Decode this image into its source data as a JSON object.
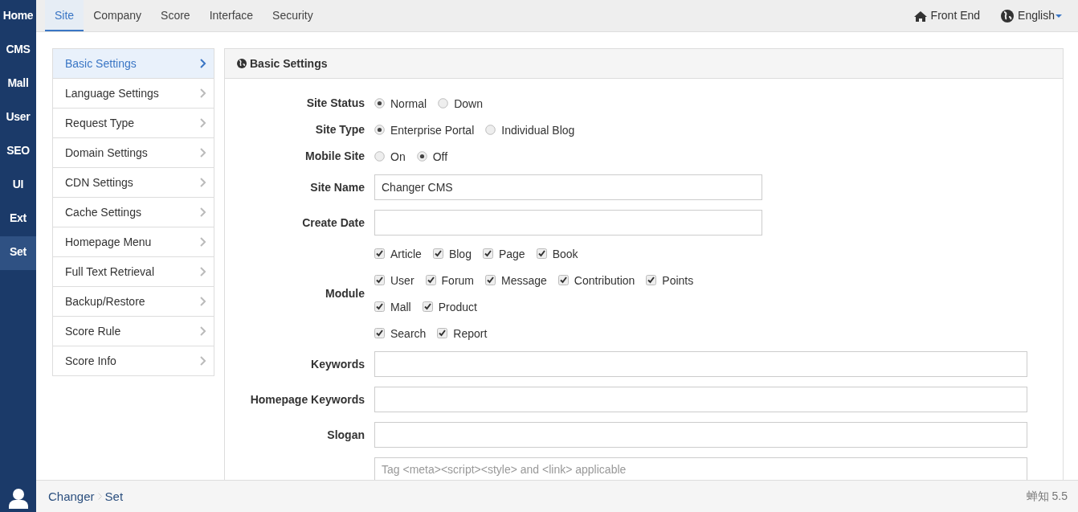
{
  "rail": {
    "items": [
      {
        "label": "Home",
        "selected": false
      },
      {
        "label": "CMS",
        "selected": false
      },
      {
        "label": "Mall",
        "selected": false
      },
      {
        "label": "User",
        "selected": false
      },
      {
        "label": "SEO",
        "selected": false
      },
      {
        "label": "UI",
        "selected": false
      },
      {
        "label": "Ext",
        "selected": false
      },
      {
        "label": "Set",
        "selected": true
      }
    ]
  },
  "tabs": [
    {
      "label": "Site",
      "selected": true
    },
    {
      "label": "Company",
      "selected": false
    },
    {
      "label": "Score",
      "selected": false
    },
    {
      "label": "Interface",
      "selected": false
    },
    {
      "label": "Security",
      "selected": false
    }
  ],
  "top_links": {
    "front_end": "Front End",
    "language": "English"
  },
  "side_menu": [
    {
      "label": "Basic Settings",
      "selected": true
    },
    {
      "label": "Language Settings",
      "selected": false
    },
    {
      "label": "Request Type",
      "selected": false
    },
    {
      "label": "Domain Settings",
      "selected": false
    },
    {
      "label": "CDN Settings",
      "selected": false
    },
    {
      "label": "Cache Settings",
      "selected": false
    },
    {
      "label": "Homepage Menu",
      "selected": false
    },
    {
      "label": "Full Text Retrieval",
      "selected": false
    },
    {
      "label": "Backup/Restore",
      "selected": false
    },
    {
      "label": "Score Rule",
      "selected": false
    },
    {
      "label": "Score Info",
      "selected": false
    }
  ],
  "panel": {
    "title": "Basic Settings",
    "fields": [
      {
        "kind": "radio",
        "label": "Site Status",
        "options": [
          {
            "label": "Normal",
            "selected": true
          },
          {
            "label": "Down",
            "selected": false
          }
        ]
      },
      {
        "kind": "radio",
        "label": "Site Type",
        "options": [
          {
            "label": "Enterprise Portal",
            "selected": true
          },
          {
            "label": "Individual Blog",
            "selected": false
          }
        ]
      },
      {
        "kind": "radio",
        "label": "Mobile Site",
        "options": [
          {
            "label": "On",
            "selected": false
          },
          {
            "label": "Off",
            "selected": true
          }
        ]
      },
      {
        "kind": "text",
        "label": "Site Name",
        "value": "Changer CMS"
      },
      {
        "kind": "text",
        "label": "Create Date"
      },
      {
        "kind": "checkboxes",
        "label": "Module",
        "rows": [
          [
            {
              "label": "Article",
              "checked": true
            },
            {
              "label": "Blog",
              "checked": true
            },
            {
              "label": "Page",
              "checked": true
            },
            {
              "label": "Book",
              "checked": true
            }
          ],
          [
            {
              "label": "User",
              "checked": true
            },
            {
              "label": "Forum",
              "checked": true
            },
            {
              "label": "Message",
              "checked": true
            },
            {
              "label": "Contribution",
              "checked": true
            },
            {
              "label": "Points",
              "checked": true
            }
          ],
          [
            {
              "label": "Mall",
              "checked": true
            },
            {
              "label": "Product",
              "checked": true
            }
          ],
          [
            {
              "label": "Search",
              "checked": true
            },
            {
              "label": "Report",
              "checked": true
            }
          ]
        ]
      },
      {
        "kind": "wide",
        "label": "Keywords"
      },
      {
        "kind": "wide",
        "label": "Homepage Keywords"
      },
      {
        "kind": "wide",
        "label": "Slogan"
      },
      {
        "kind": "textarea",
        "placeholder": "Tag <meta><script><style> and <link> applicable"
      }
    ]
  },
  "footer": {
    "breadcrumb": [
      "Changer",
      "Set"
    ],
    "version": "蝉知 5.5"
  }
}
